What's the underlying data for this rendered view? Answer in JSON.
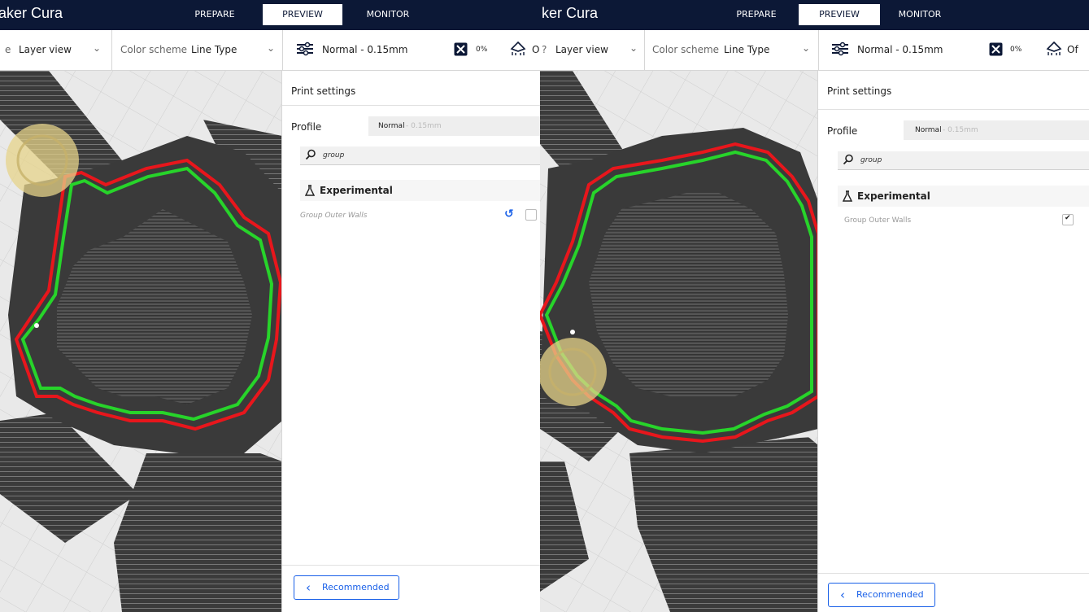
{
  "app": {
    "brand": "aker Cura",
    "brand_right": "ker Cura"
  },
  "nav": {
    "prepare": "PREPARE",
    "preview": "PREVIEW",
    "monitor": "MONITOR"
  },
  "toolbar": {
    "view_label_left": "e",
    "view_label_right": "?",
    "view_value": "Layer view",
    "color_scheme_label": "Color scheme",
    "color_scheme_value": "Line Type",
    "profile_summary": "Normal - 0.15mm",
    "infill": "0%",
    "support_left": "O",
    "support_right": "Of"
  },
  "panel": {
    "title": "Print settings",
    "profile_label": "Profile",
    "profile_name": "Normal",
    "profile_detail": " - 0.15mm",
    "search_text": "group",
    "category": "Experimental",
    "setting_label": "Group Outer Walls",
    "left_checkbox_checked": false,
    "right_checkbox_checked": true,
    "recommended_label": "Recommended"
  },
  "colors": {
    "brand_bg": "#0c1836",
    "accent": "#1960e8",
    "outer_wall": "#e8161c",
    "inner_wall": "#27d42a",
    "travel_marker": "#e6d38a"
  }
}
